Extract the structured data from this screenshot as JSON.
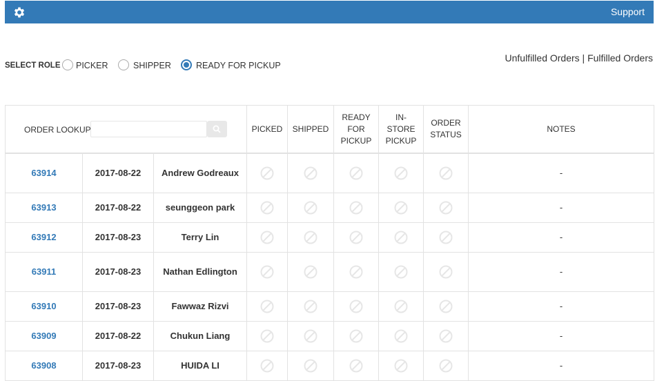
{
  "header": {
    "support_label": "Support"
  },
  "role": {
    "label": "SELECT ROLE :",
    "options": [
      {
        "label": "PICKER",
        "selected": false
      },
      {
        "label": "SHIPPER",
        "selected": false
      },
      {
        "label": "READY FOR PICKUP",
        "selected": true
      }
    ]
  },
  "links": {
    "unfulfilled": "Unfulfilled Orders",
    "separator": "|",
    "fulfilled": "Fulfilled Orders"
  },
  "lookup": {
    "label": "ORDER LOOKUP",
    "value": "",
    "placeholder": ""
  },
  "columns": {
    "picked": "PICKED",
    "shipped": "SHIPPED",
    "ready_for_pickup": [
      "READY",
      "FOR",
      "PICKUP"
    ],
    "in_store_pickup": [
      "IN-",
      "STORE",
      "PICKUP"
    ],
    "order_status": [
      "ORDER",
      "STATUS"
    ],
    "notes": "NOTES"
  },
  "status_icon": "not-available-icon",
  "colors": {
    "header_bar": "#337ab7",
    "link": "#337ab7",
    "status_icon": "#e6e6e6"
  },
  "rows": [
    {
      "order": "63914",
      "date": "2017-08-22",
      "name": "Andrew Godreaux",
      "notes": "-"
    },
    {
      "order": "63913",
      "date": "2017-08-22",
      "name": "seunggeon park",
      "notes": "-"
    },
    {
      "order": "63912",
      "date": "2017-08-23",
      "name": "Terry Lin",
      "notes": "-"
    },
    {
      "order": "63911",
      "date": "2017-08-23",
      "name": "Nathan Edlington",
      "notes": "-"
    },
    {
      "order": "63910",
      "date": "2017-08-23",
      "name": "Fawwaz Rizvi",
      "notes": "-"
    },
    {
      "order": "63909",
      "date": "2017-08-22",
      "name": "Chukun Liang",
      "notes": "-"
    },
    {
      "order": "63908",
      "date": "2017-08-23",
      "name": "HUIDA LI",
      "notes": "-"
    }
  ]
}
